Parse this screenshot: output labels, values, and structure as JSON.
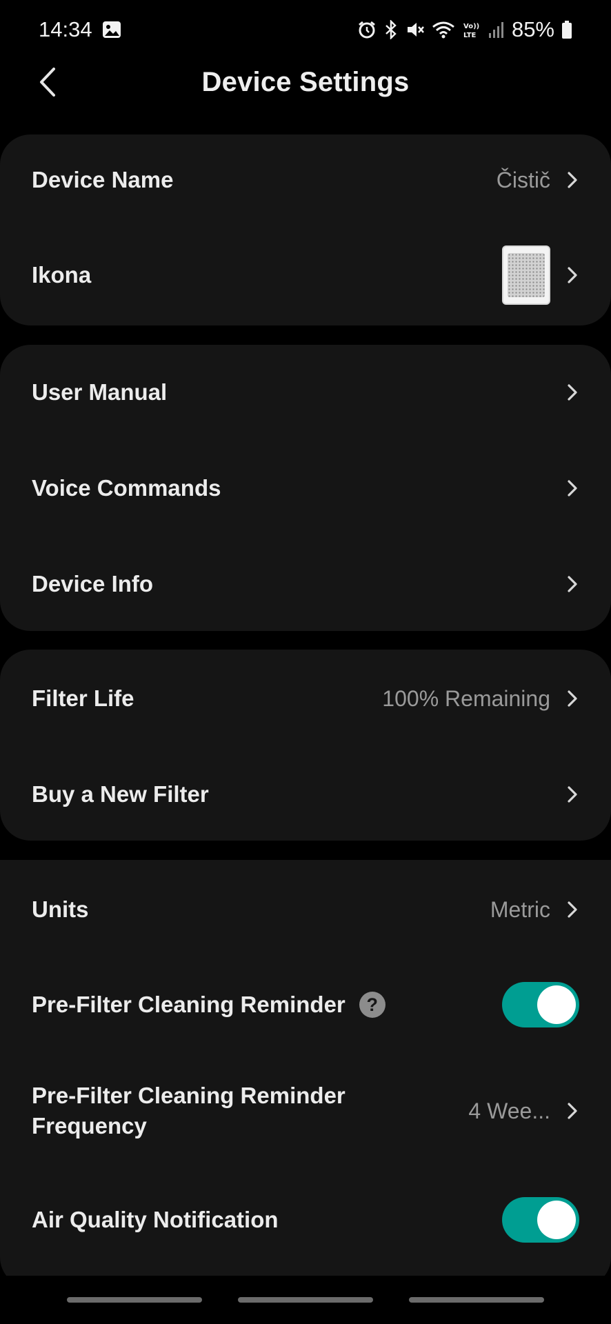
{
  "status_bar": {
    "time": "14:34",
    "battery": "85%",
    "icons": [
      "gallery-icon",
      "alarm-icon",
      "bluetooth-icon",
      "mute-icon",
      "wifi-icon",
      "volte-icon",
      "signal-icon",
      "battery-icon"
    ]
  },
  "header": {
    "title": "Device Settings"
  },
  "groups": {
    "device": {
      "name_label": "Device Name",
      "name_value": "Čistič",
      "icon_label": "Ikona"
    },
    "help": {
      "manual_label": "User Manual",
      "voice_label": "Voice Commands",
      "info_label": "Device Info"
    },
    "filter": {
      "life_label": "Filter Life",
      "life_value": "100% Remaining",
      "life_percent": 100,
      "buy_label": "Buy a New Filter"
    },
    "preferences": {
      "units_label": "Units",
      "units_value": "Metric",
      "prefilter_reminder_label": "Pre-Filter Cleaning Reminder",
      "prefilter_reminder_help": "?",
      "prefilter_reminder_on": true,
      "prefilter_frequency_label_line1": "Pre-Filter Cleaning Reminder",
      "prefilter_frequency_label_line2": "Frequency",
      "prefilter_frequency_value": "4 Wee...",
      "air_quality_label": "Air Quality Notification",
      "air_quality_on": true
    }
  },
  "colors": {
    "background": "#000000",
    "card": "#151515",
    "toggle_on": "#009e92",
    "secondary_text": "#9a9a9a"
  }
}
